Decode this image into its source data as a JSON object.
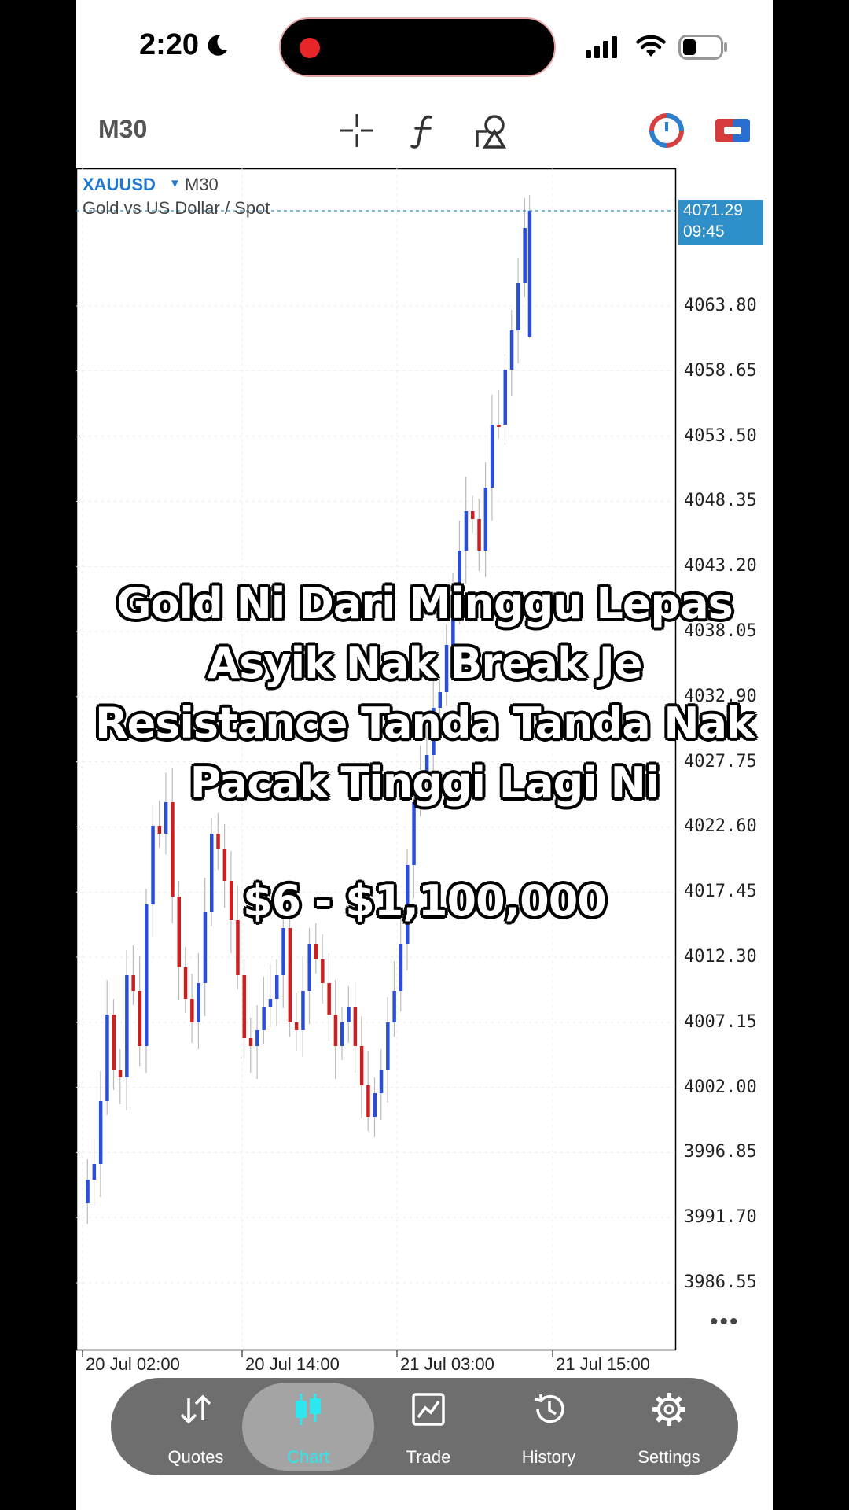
{
  "status": {
    "time": "2:20"
  },
  "toolbar": {
    "timeframe": "M30"
  },
  "chart": {
    "symbol": "XAUUSD",
    "symbol_timeframe": "M30",
    "description": "Gold vs US Dollar / Spot",
    "current_price": "4071.29",
    "current_time": "09:45"
  },
  "chart_data": {
    "type": "candlestick",
    "price_ticks": [
      "4063.80",
      "4058.65",
      "4053.50",
      "4048.35",
      "4043.20",
      "4038.05",
      "4032.90",
      "4027.75",
      "4022.60",
      "4017.45",
      "4012.30",
      "4007.15",
      "4002.00",
      "3996.85",
      "3991.70",
      "3986.55"
    ],
    "time_ticks": [
      "20 Jul 02:00",
      "20 Jul 14:00",
      "21 Jul 03:00",
      "21 Jul 15:00"
    ],
    "last_price": 4071.29,
    "colors": {
      "up": "#2a4fd6",
      "down": "#cc2020"
    }
  },
  "overlay": {
    "lines": [
      "Gold Ni Dari Minggu Lepas",
      "Asyik Nak Break Je",
      "Resistance Tanda Tanda Nak",
      "Pacak Tinggi Lagi Ni"
    ],
    "price_range": "$6 - $1,100,000"
  },
  "nav": {
    "items": [
      {
        "label": "Quotes"
      },
      {
        "label": "Chart"
      },
      {
        "label": "Trade"
      },
      {
        "label": "History"
      },
      {
        "label": "Settings"
      }
    ],
    "active_color": "#2ee6f0"
  }
}
